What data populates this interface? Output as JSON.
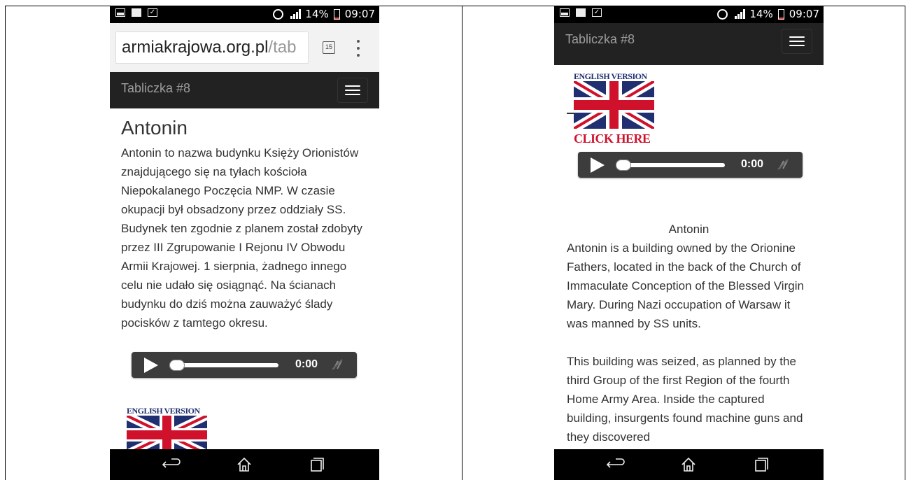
{
  "status_bar": {
    "battery": "14%",
    "time": "09:07"
  },
  "browser": {
    "url_host": "armiakrajowa.org.pl",
    "url_path": "/tab",
    "tabs_count": "15"
  },
  "navbar": {
    "brand": "Tabliczka #8"
  },
  "left_page": {
    "heading": "Antonin",
    "paragraph": "Antonin to nazwa budynku Księży Orionistów znajdującego się na tyłach kościoła Niepokalanego Poczęcia NMP. W czasie okupacji był obsadzony przez oddziały SS. Budynek ten zgodnie z planem został zdobyty przez III Zgrupowanie I Rejonu IV Obwodu Armii Krajowej. 1 sierpnia, żadnego innego celu nie udało się osiągnąć. Na ścianach budynku do dziś można zauważyć ślady pocisków z tamtego okresu."
  },
  "audio_player": {
    "time": "0:00",
    "progress": 0
  },
  "english_banner": {
    "top_label": "ENGLISH VERSION",
    "bottom_label": "CLICK HERE"
  },
  "right_page": {
    "title": "Antonin",
    "paragraph1": "Antonin is a building owned by the Orionine Fathers, located in the back of the Church of Immaculate Conception of the Blessed Virgin Mary. During Nazi occupation of Warsaw it was manned by SS units.",
    "paragraph2": "This building was seized, as planned by the third Group of the first Region of the fourth Home Army Area. Inside the captured building, insurgents found machine guns and they discovered"
  },
  "colors": {
    "navbar": "#222222",
    "player": "#3c3c3c",
    "flag_blue": "#1f2f70",
    "flag_red": "#d0112b"
  }
}
